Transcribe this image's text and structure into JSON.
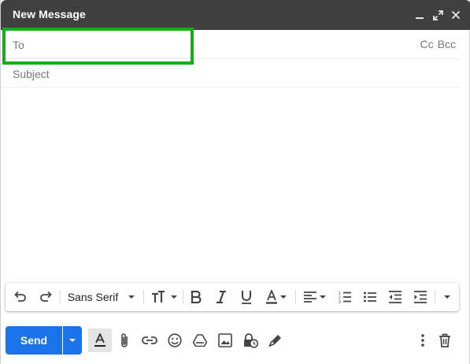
{
  "window": {
    "title": "New Message"
  },
  "recipients": {
    "to_placeholder": "To",
    "cc_label": "Cc",
    "bcc_label": "Bcc"
  },
  "subject": {
    "placeholder": "Subject"
  },
  "format_toolbar": {
    "font_family": "Sans Serif"
  },
  "actions": {
    "send_label": "Send"
  },
  "colors": {
    "titlebar": "#404040",
    "send_button": "#1a73e8",
    "highlight": "#16ad16"
  }
}
